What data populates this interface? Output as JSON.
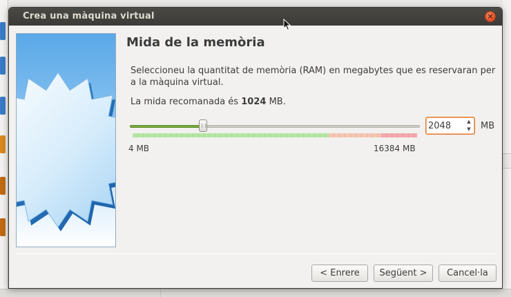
{
  "dialog": {
    "title": "Crea una màquina virtual",
    "close_icon": "close-icon"
  },
  "page": {
    "heading": "Mida de la memòria",
    "description": "Seleccioneu la quantitat de memòria (RAM) en megabytes que es reservaran per a la màquina virtual.",
    "recommended_prefix": "La mida recomanada és",
    "recommended_value": "1024",
    "recommended_suffix": "MB."
  },
  "memory": {
    "value": "2048",
    "unit": "MB",
    "min_label": "4 MB",
    "max_label": "16384 MB",
    "min": 4,
    "max": 16384,
    "current": 2048,
    "zones": [
      {
        "kind": "green",
        "fraction": 0.69
      },
      {
        "kind": "orange",
        "fraction": 0.185
      },
      {
        "kind": "red",
        "fraction": 0.125
      }
    ]
  },
  "buttons": {
    "back": "< Enrere",
    "next": "Següent >",
    "cancel": "Cancel·la"
  },
  "colors": {
    "titlebar": "#3c3b37",
    "close": "#df4b20",
    "slider_fill": "#6a9a2e",
    "focus": "#e07b2b"
  }
}
